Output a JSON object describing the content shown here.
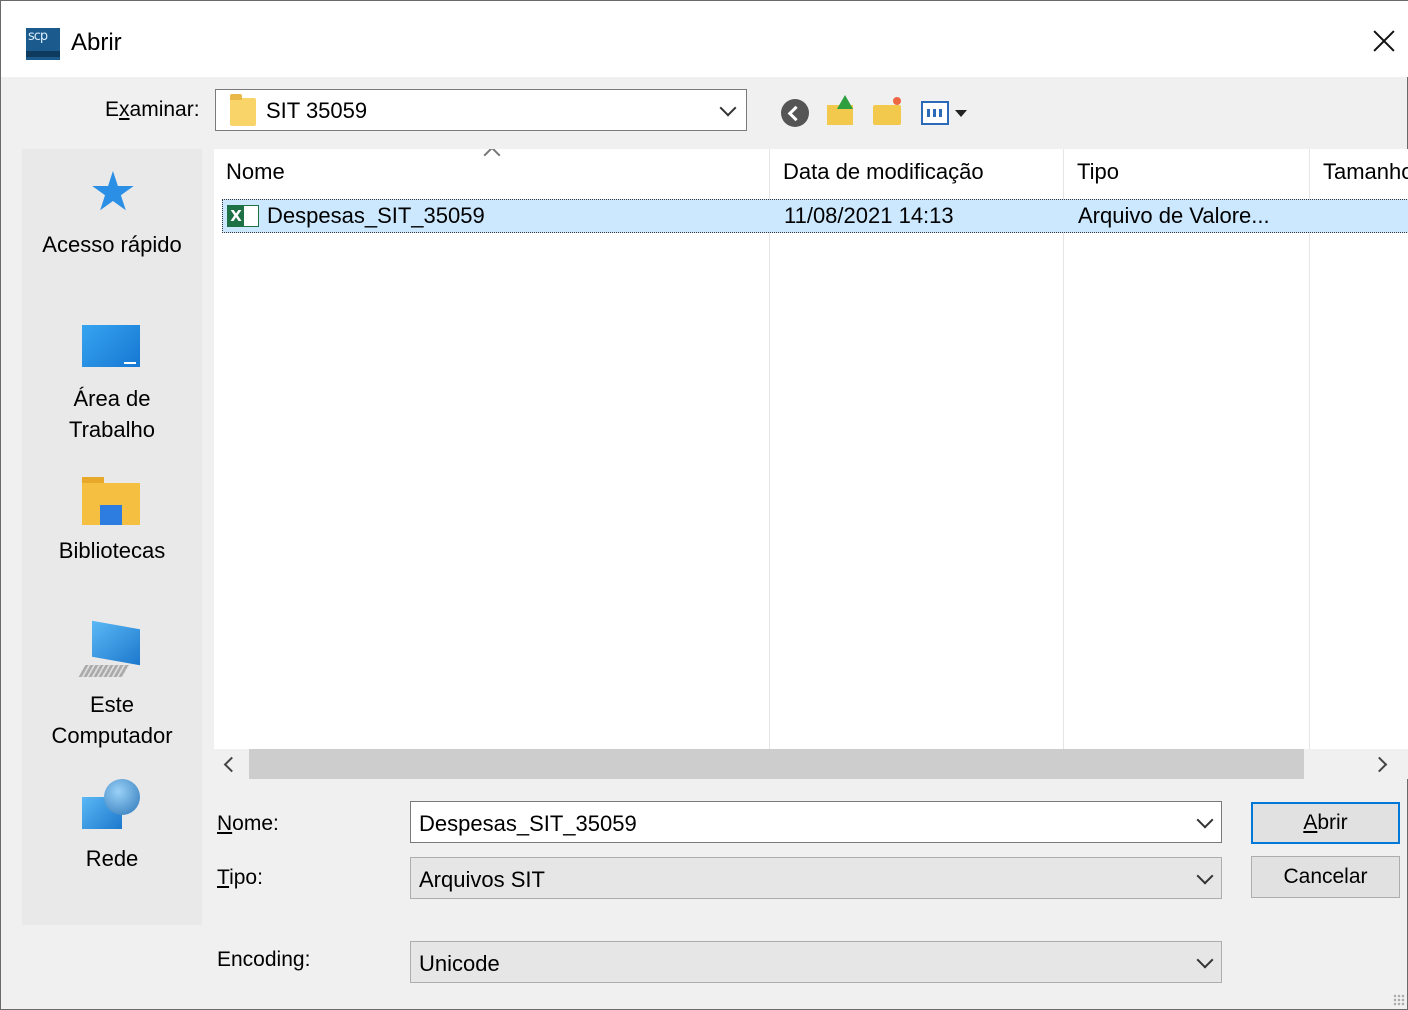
{
  "window": {
    "title": "Abrir",
    "app_icon_text": "scp"
  },
  "toolbar": {
    "lookin_label_pre": "E",
    "lookin_label_ul": "x",
    "lookin_label_post": "aminar:",
    "lookin_value": "SIT 35059"
  },
  "places": [
    {
      "label": "Acesso rápido",
      "icon": "quick-access-star-icon"
    },
    {
      "label": "Área de",
      "label2": "Trabalho",
      "icon": "desktop-icon"
    },
    {
      "label": "Bibliotecas",
      "icon": "libraries-icon"
    },
    {
      "label": "Este",
      "label2": "Computador",
      "icon": "computer-icon"
    },
    {
      "label": "Rede",
      "icon": "network-icon"
    }
  ],
  "filelist": {
    "columns": [
      "Nome",
      "Data de modificação",
      "Tipo",
      "Tamanho"
    ],
    "rows": [
      {
        "name": "Despesas_SIT_35059",
        "date": "11/08/2021 14:13",
        "type": "Arquivo de Valore...",
        "size": "",
        "selected": true
      }
    ]
  },
  "form": {
    "name_label_ul": "N",
    "name_label_post": "ome:",
    "name_value": "Despesas_SIT_35059",
    "type_label_ul": "T",
    "type_label_post": "ipo:",
    "type_value": "Arquivos SIT",
    "encoding_label": "Encoding:",
    "encoding_value": "Unicode"
  },
  "buttons": {
    "open_ul": "A",
    "open_post": "brir",
    "cancel": "Cancelar"
  },
  "colors": {
    "selection": "#cce8ff",
    "default_button_border": "#0078d7"
  }
}
